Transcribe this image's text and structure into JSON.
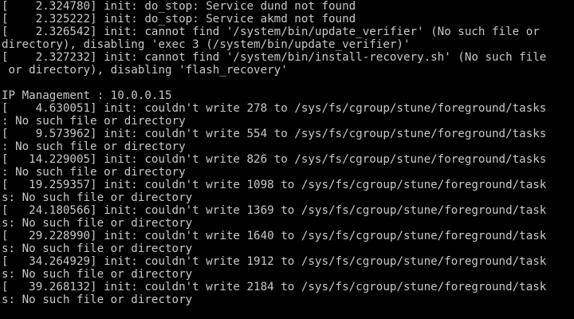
{
  "console": {
    "lines": [
      "[    2.324780] init: do_stop: Service dund not found",
      "[    2.325222] init: do_stop: Service akmd not found",
      "[    2.326542] init: cannot find '/system/bin/update_verifier' (No such file or",
      "directory), disabling 'exec 3 (/system/bin/update_verifier)'",
      "[    2.327232] init: cannot find '/system/bin/install-recovery.sh' (No such file",
      " or directory), disabling 'flash_recovery'",
      "",
      "IP Management : 10.0.0.15",
      "[    4.630051] init: couldn't write 278 to /sys/fs/cgroup/stune/foreground/tasks",
      ": No such file or directory",
      "[    9.573962] init: couldn't write 554 to /sys/fs/cgroup/stune/foreground/tasks",
      ": No such file or directory",
      "[   14.229005] init: couldn't write 826 to /sys/fs/cgroup/stune/foreground/tasks",
      ": No such file or directory",
      "[   19.259357] init: couldn't write 1098 to /sys/fs/cgroup/stune/foreground/task",
      "s: No such file or directory",
      "[   24.180566] init: couldn't write 1369 to /sys/fs/cgroup/stune/foreground/task",
      "s: No such file or directory",
      "[   29.228990] init: couldn't write 1640 to /sys/fs/cgroup/stune/foreground/task",
      "s: No such file or directory",
      "[   34.264929] init: couldn't write 1912 to /sys/fs/cgroup/stune/foreground/task",
      "s: No such file or directory",
      "[   39.268132] init: couldn't write 2184 to /sys/fs/cgroup/stune/foreground/task",
      "s: No such file or directory"
    ],
    "text_color": "#c8c8c8",
    "background_color": "#000000"
  }
}
